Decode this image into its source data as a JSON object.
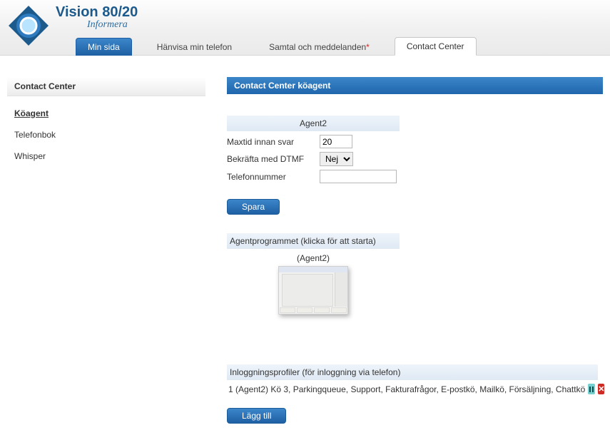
{
  "brand": {
    "title": "Vision 80/20",
    "subtitle": "Informera"
  },
  "tabs": {
    "mypage": "Min sida",
    "forward": "Hänvisa min telefon",
    "calls": "Samtal och meddelanden",
    "contact": "Contact Center"
  },
  "sidebar": {
    "header": "Contact Center",
    "items": {
      "agent": "Köagent",
      "phonebook": "Telefonbok",
      "whisper": "Whisper"
    }
  },
  "panel_title": "Contact Center köagent",
  "agent_form": {
    "header": "Agent2",
    "maxtime_label": "Maxtid innan svar",
    "maxtime_value": "20",
    "dtmf_label": "Bekräfta med DTMF",
    "dtmf_value": "Nej",
    "phone_label": "Telefonnummer",
    "phone_value": "",
    "save_btn": "Spara"
  },
  "agent_launch": {
    "header": "Agentprogrammet (klicka för att starta)",
    "link": "(Agent2)"
  },
  "login_profiles": {
    "header": "Inloggningsprofiler (för inloggning via telefon)",
    "row_text": "1 (Agent2) Kö 3, Parkingqueue, Support, Fakturafrågor, E-postkö, Mailkö, Försäljning, Chattkö",
    "add_btn": "Lägg till"
  }
}
